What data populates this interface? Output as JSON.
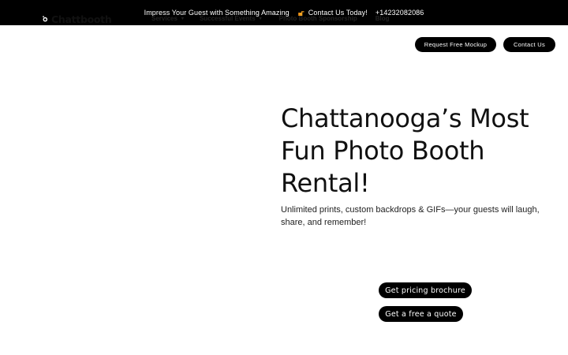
{
  "topbar": {
    "tagline": "Impress  Your Guest with Something Amazing",
    "contact_icon": "pointing-hand-icon",
    "contact_text": "Contact Us Today!",
    "phone": "+14232082086"
  },
  "header": {
    "logo_text": "Chattbooth",
    "logo_icon": "camera-icon",
    "menu": {
      "services": "Services",
      "events": "Successful Events",
      "sponsorship": "Photo Booth Sponsorship",
      "blog": "Blog"
    },
    "caret_icon": "chevron-down-icon",
    "mockup_button": "Request Free Mockup",
    "contact_button": "Contact Us"
  },
  "hero": {
    "title": "Chattanooga’s Most Fun Photo Booth Rental!",
    "subtitle": "Unlimited prints, custom backdrops & GIFs—your guests will laugh, share, and remember!",
    "brochure_button": "Get pricing brochure",
    "quote_button": "Get a free a quote"
  },
  "colors": {
    "topbar_bg": "#000000",
    "button_bg": "#000000",
    "accent_icon": "#f0a020",
    "page_bg": "#ffffff"
  }
}
